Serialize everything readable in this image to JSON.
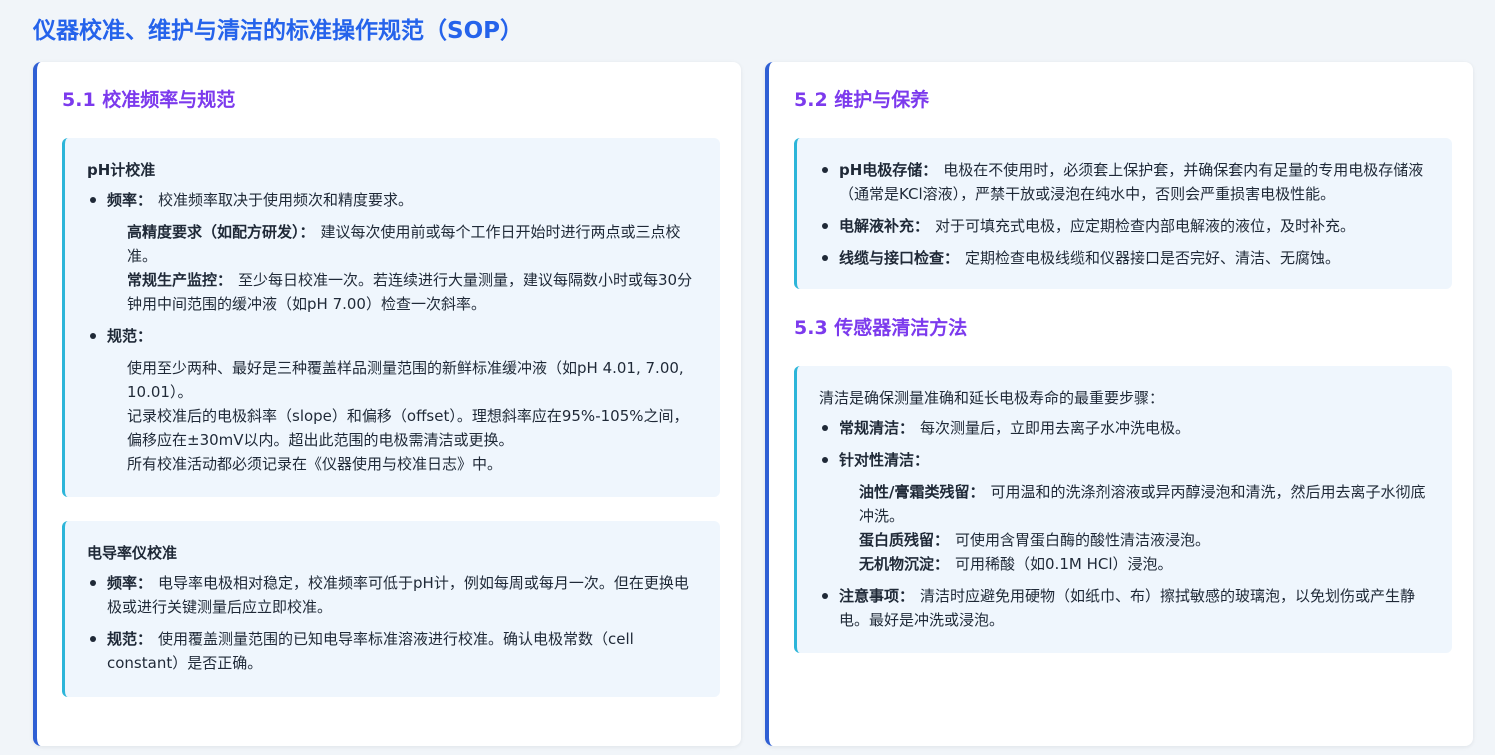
{
  "title": "仪器校准、维护与清洁的标准操作规范（SOP）",
  "s51": {
    "heading": "5.1 校准频率与规范",
    "ph": {
      "title": "pH计校准",
      "freq_label": "频率：",
      "freq_text": "校准频率取决于使用频次和精度要求。",
      "hp_label": "高精度要求（如配方研发）：",
      "hp_text": "建议每次使用前或每个工作日开始时进行两点或三点校准。",
      "rp_label": "常规生产监控：",
      "rp_text": "至少每日校准一次。若连续进行大量测量，建议每隔数小时或每30分钟用中间范围的缓冲液（如pH 7.00）检查一次斜率。",
      "spec_label": "规范：",
      "spec_1": "使用至少两种、最好是三种覆盖样品测量范围的新鲜标准缓冲液（如pH 4.01, 7.00, 10.01）。",
      "spec_2": "记录校准后的电极斜率（slope）和偏移（offset）。理想斜率应在95%-105%之间，偏移应在±30mV以内。超出此范围的电极需清洁或更换。",
      "spec_3": "所有校准活动都必须记录在《仪器使用与校准日志》中。"
    },
    "ec": {
      "title": "电导率仪校准",
      "freq_label": "频率：",
      "freq_text": "电导率电极相对稳定，校准频率可低于pH计，例如每周或每月一次。但在更换电极或进行关键测量后应立即校准。",
      "spec_label": "规范：",
      "spec_text": "使用覆盖测量范围的已知电导率标准溶液进行校准。确认电极常数（cell constant）是否正确。"
    }
  },
  "s52": {
    "heading": "5.2 维护与保养",
    "storage_label": "pH电极存储：",
    "storage_text": "电极在不使用时，必须套上保护套，并确保套内有足量的专用电极存储液（通常是KCl溶液），严禁干放或浸泡在纯水中，否则会严重损害电极性能。",
    "refill_label": "电解液补充：",
    "refill_text": "对于可填充式电极，应定期检查内部电解液的液位，及时补充。",
    "cable_label": "线缆与接口检查：",
    "cable_text": "定期检查电极线缆和仪器接口是否完好、清洁、无腐蚀。"
  },
  "s53": {
    "heading": "5.3 传感器清洁方法",
    "intro": "清洁是确保测量准确和延长电极寿命的最重要步骤：",
    "routine_label": "常规清洁：",
    "routine_text": "每次测量后，立即用去离子水冲洗电极。",
    "targeted_label": "针对性清洁：",
    "oil_label": "油性/膏霜类残留：",
    "oil_text": "可用温和的洗涤剂溶液或异丙醇浸泡和清洗，然后用去离子水彻底冲洗。",
    "protein_label": "蛋白质残留：",
    "protein_text": "可使用含胃蛋白酶的酸性清洁液浸泡。",
    "inorganic_label": "无机物沉淀：",
    "inorganic_text": "可用稀酸（如0.1M HCl）浸泡。",
    "note_label": "注意事项：",
    "note_text": "清洁时应避免用硬物（如纸巾、布）擦拭敏感的玻璃泡，以免划伤或产生静电。最好是冲洗或浸泡。"
  }
}
